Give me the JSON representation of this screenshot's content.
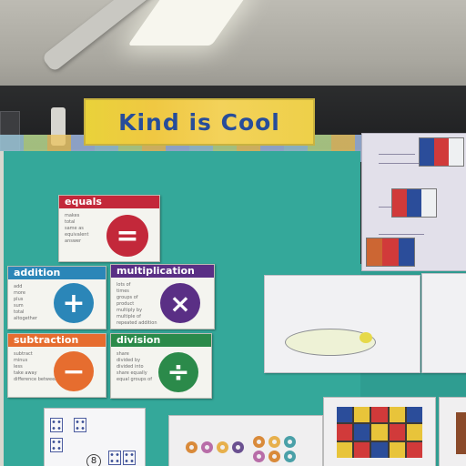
{
  "banner": {
    "text": "Kind is Cool"
  },
  "cards": {
    "equals": {
      "title": "equals",
      "symbol": "=",
      "words": [
        "makes",
        "total",
        "same as",
        "equivalent",
        "answer"
      ],
      "color": "#c3283a"
    },
    "addition": {
      "title": "addition",
      "symbol": "+",
      "words": [
        "add",
        "more",
        "plus",
        "sum",
        "total",
        "altogether"
      ],
      "color": "#2b86b8"
    },
    "multiplication": {
      "title": "multiplication",
      "symbol": "×",
      "words": [
        "lots of",
        "times",
        "groups of",
        "product",
        "multiply by",
        "multiple of",
        "repeated addition"
      ],
      "color": "#5a2f85"
    },
    "subtraction": {
      "title": "subtraction",
      "symbol": "−",
      "words": [
        "subtract",
        "minus",
        "less",
        "take away",
        "difference between"
      ],
      "color": "#e66d2f"
    },
    "division": {
      "title": "division",
      "symbol": "÷",
      "words": [
        "share",
        "divided by",
        "divided into",
        "share equally",
        "equal groups of"
      ],
      "color": "#2b8a4a"
    }
  },
  "math_card": {
    "number": "8"
  },
  "colors": {
    "board": "#34a89a",
    "banner": "#f0c842",
    "banner_text": "#274d9a"
  }
}
